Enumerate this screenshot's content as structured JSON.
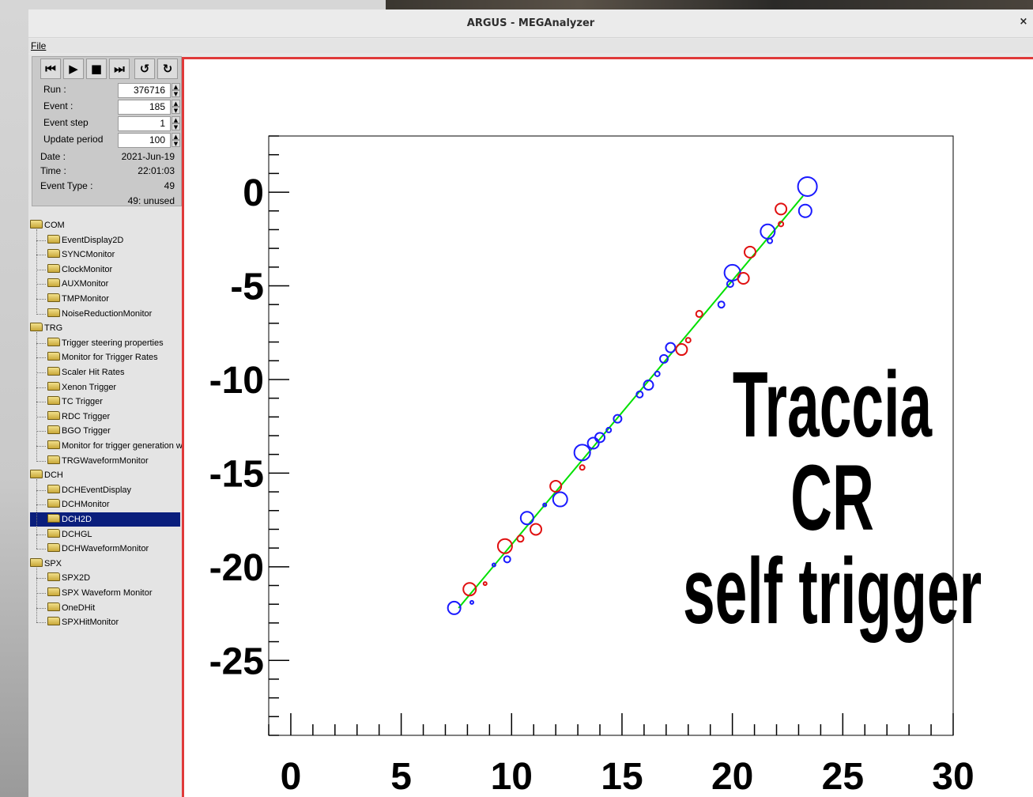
{
  "window": {
    "title": "ARGUS - MEGAnalyzer",
    "close_glyph": "×"
  },
  "menu": {
    "file_label": "File"
  },
  "toolbar": {
    "buttons": [
      {
        "name": "rewind-icon",
        "glyph": "⏮"
      },
      {
        "name": "play-icon",
        "glyph": "▶"
      },
      {
        "name": "stop-icon",
        "glyph": "■"
      },
      {
        "name": "step-forward-icon",
        "glyph": "⏭"
      },
      {
        "name": "reload-icon",
        "glyph": "↺"
      },
      {
        "name": "refresh-icon",
        "glyph": "↻"
      }
    ]
  },
  "controls": {
    "run_label": "Run :",
    "run_value": "376716",
    "event_label": "Event :",
    "event_value": "185",
    "event_step_label": "Event step",
    "event_step_value": "1",
    "update_period_label": "Update period",
    "update_period_value": "100",
    "date_label": "Date :",
    "date_value": "2021-Jun-19",
    "time_label": "Time :",
    "time_value": "22:01:03",
    "event_type_label": "Event Type :",
    "event_type_value": "49",
    "event_type_desc": "49: unused"
  },
  "tree": {
    "groups": [
      {
        "label": "COM",
        "items": [
          "EventDisplay2D",
          "SYNCMonitor",
          "ClockMonitor",
          "AUXMonitor",
          "TMPMonitor",
          "NoiseReductionMonitor"
        ]
      },
      {
        "label": "TRG",
        "items": [
          "Trigger steering properties",
          "Monitor for Trigger Rates",
          "Scaler Hit Rates",
          "Xenon Trigger",
          "TC Trigger",
          "RDC Trigger",
          "BGO Trigger",
          "Monitor for trigger generation wa",
          "TRGWaveformMonitor"
        ]
      },
      {
        "label": "DCH",
        "items": [
          "DCHEventDisplay",
          "DCHMonitor",
          "DCH2D",
          "DCHGL",
          "DCHWaveformMonitor"
        ]
      },
      {
        "label": "SPX",
        "items": [
          "SPX2D",
          "SPX Waveform Monitor",
          "OneDHit",
          "SPXHitMonitor"
        ]
      }
    ],
    "selected": "DCH2D"
  },
  "overlay": {
    "line1": "Traccia",
    "line2": "CR",
    "line3": "self trigger"
  },
  "chart_data": {
    "type": "scatter",
    "xlim": [
      -1,
      30
    ],
    "ylim": [
      -29,
      3
    ],
    "x_ticks": [
      0,
      5,
      10,
      15,
      20,
      25,
      30
    ],
    "y_ticks": [
      0,
      -5,
      -10,
      -15,
      -20,
      -25
    ],
    "grid": false,
    "colors": {
      "blue": "#1a1aff",
      "red": "#e01010",
      "fit": "#00e000"
    },
    "fit_line": {
      "x": [
        7.6,
        23.2
      ],
      "y": [
        -22.2,
        -0.2
      ]
    },
    "series": [
      {
        "color": "blue",
        "points": [
          {
            "x": 7.4,
            "y": -22.2,
            "r": 8
          },
          {
            "x": 8.2,
            "y": -21.9,
            "r": 2
          },
          {
            "x": 9.2,
            "y": -19.9,
            "r": 2
          },
          {
            "x": 9.8,
            "y": -19.6,
            "r": 4
          },
          {
            "x": 10.7,
            "y": -17.4,
            "r": 8
          },
          {
            "x": 11.5,
            "y": -16.7,
            "r": 2
          },
          {
            "x": 12.2,
            "y": -16.4,
            "r": 9
          },
          {
            "x": 13.2,
            "y": -13.9,
            "r": 10
          },
          {
            "x": 13.7,
            "y": -13.4,
            "r": 7
          },
          {
            "x": 14.0,
            "y": -13.1,
            "r": 6
          },
          {
            "x": 14.4,
            "y": -12.7,
            "r": 3
          },
          {
            "x": 14.8,
            "y": -12.1,
            "r": 5
          },
          {
            "x": 15.8,
            "y": -10.8,
            "r": 4
          },
          {
            "x": 16.2,
            "y": -10.3,
            "r": 6
          },
          {
            "x": 16.6,
            "y": -9.7,
            "r": 3
          },
          {
            "x": 16.9,
            "y": -8.9,
            "r": 5
          },
          {
            "x": 17.2,
            "y": -8.3,
            "r": 6
          },
          {
            "x": 19.5,
            "y": -6.0,
            "r": 4
          },
          {
            "x": 19.9,
            "y": -4.9,
            "r": 4
          },
          {
            "x": 20.0,
            "y": -4.3,
            "r": 10
          },
          {
            "x": 21.6,
            "y": -2.1,
            "r": 9
          },
          {
            "x": 21.7,
            "y": -2.6,
            "r": 3
          },
          {
            "x": 23.3,
            "y": -1.0,
            "r": 8
          },
          {
            "x": 23.4,
            "y": 0.3,
            "r": 12
          }
        ]
      },
      {
        "color": "red",
        "points": [
          {
            "x": 8.1,
            "y": -21.2,
            "r": 8
          },
          {
            "x": 8.8,
            "y": -20.9,
            "r": 2
          },
          {
            "x": 9.7,
            "y": -18.9,
            "r": 9
          },
          {
            "x": 10.4,
            "y": -18.5,
            "r": 4
          },
          {
            "x": 11.1,
            "y": -18.0,
            "r": 7
          },
          {
            "x": 12.0,
            "y": -15.7,
            "r": 7
          },
          {
            "x": 13.2,
            "y": -14.7,
            "r": 3
          },
          {
            "x": 17.7,
            "y": -8.4,
            "r": 7
          },
          {
            "x": 18.0,
            "y": -7.9,
            "r": 3
          },
          {
            "x": 18.5,
            "y": -6.5,
            "r": 4
          },
          {
            "x": 20.5,
            "y": -4.6,
            "r": 7
          },
          {
            "x": 20.8,
            "y": -3.2,
            "r": 7
          },
          {
            "x": 22.2,
            "y": -0.9,
            "r": 7
          },
          {
            "x": 22.2,
            "y": -1.7,
            "r": 3
          }
        ]
      }
    ]
  }
}
